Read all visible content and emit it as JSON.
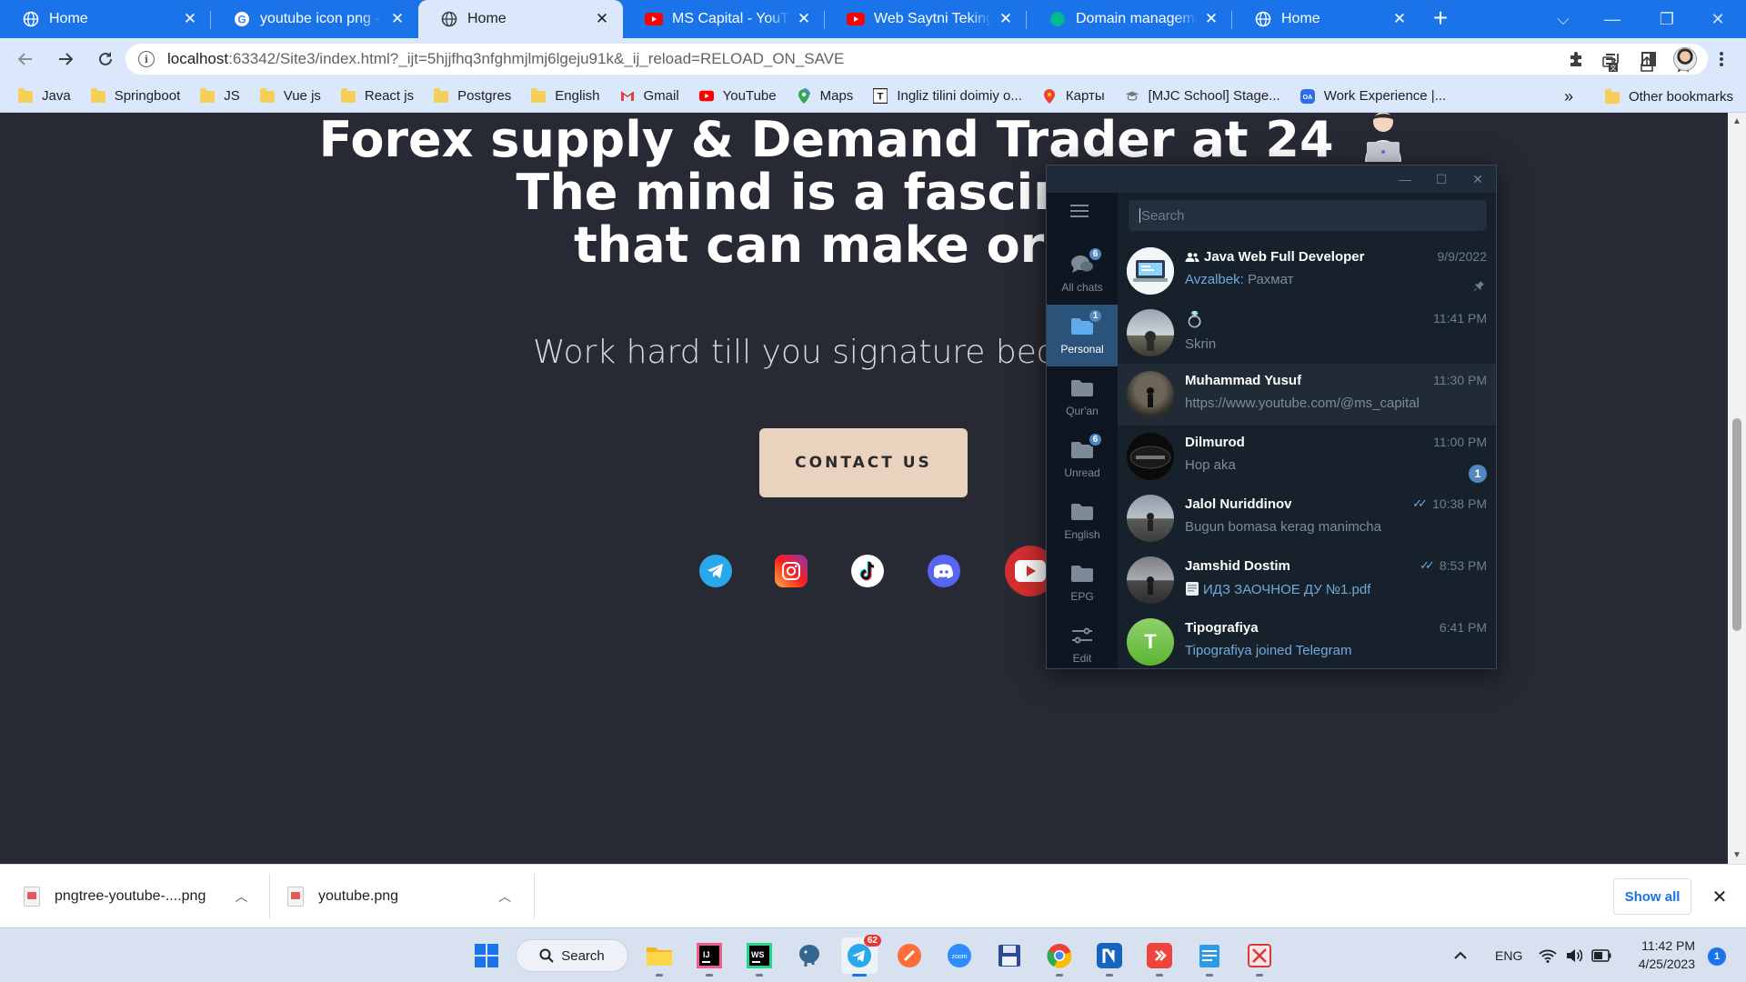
{
  "browser": {
    "tabs": [
      {
        "title": "Home",
        "icon": "globe-icon"
      },
      {
        "title": "youtube icon png - Google Search",
        "icon": "google-icon"
      },
      {
        "title": "Home",
        "icon": "globe-icon",
        "active": true
      },
      {
        "title": "MS Capital - YouTube",
        "icon": "youtube-icon"
      },
      {
        "title": "Web Saytni Tekinga Ho'",
        "icon": "youtube-icon"
      },
      {
        "title": "Domain management",
        "icon": "domain-icon"
      },
      {
        "title": "Home",
        "icon": "globe-icon"
      }
    ],
    "new_tab": "+",
    "close_glyph": "✕",
    "address": {
      "host": "localhost",
      "rest": ":63342/Site3/index.html?_ijt=5hjjfhq3nfghmjlmj6lgeju91k&_ij_reload=RELOAD_ON_SAVE"
    },
    "bookmarks": [
      {
        "label": "Java",
        "icon": "folder-icon"
      },
      {
        "label": "Springboot",
        "icon": "folder-icon"
      },
      {
        "label": "JS",
        "icon": "folder-icon"
      },
      {
        "label": "Vue js",
        "icon": "folder-icon"
      },
      {
        "label": "React js",
        "icon": "folder-icon"
      },
      {
        "label": "Postgres",
        "icon": "folder-icon"
      },
      {
        "label": "English",
        "icon": "folder-icon"
      },
      {
        "label": "Gmail",
        "icon": "gmail-icon"
      },
      {
        "label": "YouTube",
        "icon": "youtube-icon"
      },
      {
        "label": "Maps",
        "icon": "maps-icon"
      },
      {
        "label": "Ingliz tilini doimiy o...",
        "icon": "t-icon"
      },
      {
        "label": "Карты",
        "icon": "maps-icon"
      },
      {
        "label": "[MJC School] Stage...",
        "icon": "mjc-icon"
      },
      {
        "label": "Work Experience |...",
        "icon": "oa-icon"
      }
    ],
    "bookmarks_more": "»",
    "other_bookmarks": "Other bookmarks"
  },
  "page": {
    "title_line1": "Forex supply & Demand Trader at 24",
    "title_line2": "The mind is a fascinating",
    "title_line3": "that can make or bre",
    "subtitle": "Work hard till you signature becomes an",
    "contact_button": "CONTACT US",
    "social_icons": [
      "telegram-icon",
      "instagram-icon",
      "tiktok-icon",
      "discord-icon",
      "youtube-icon"
    ]
  },
  "telegram": {
    "search_placeholder": "Search",
    "folders": [
      {
        "label": "All chats",
        "badge": "6",
        "icon": "chats-icon"
      },
      {
        "label": "Personal",
        "badge": "1",
        "icon": "folder-icon",
        "active": true
      },
      {
        "label": "Qur'an",
        "badge": "",
        "icon": "folder-icon"
      },
      {
        "label": "Unread",
        "badge": "6",
        "icon": "folder-icon"
      },
      {
        "label": "English",
        "badge": "",
        "icon": "folder-icon"
      },
      {
        "label": "EPG",
        "badge": "",
        "icon": "folder-icon"
      },
      {
        "label": "Edit",
        "badge": "",
        "icon": "sliders-icon"
      }
    ],
    "chats": [
      {
        "name": "Java Web Full Developer",
        "sender": "Avzalbek:",
        "message": "Рахмат",
        "time": "9/9/2022",
        "group": true,
        "pinned": true
      },
      {
        "name": "",
        "message": "Skrin",
        "time": "11:41 PM",
        "ring_emoji": "💍"
      },
      {
        "name": "Muhammad Yusuf",
        "message": "https://www.youtube.com/@ms_capital",
        "time": "11:30 PM",
        "highlight": true
      },
      {
        "name": "Dilmurod",
        "message": "Hop aka",
        "time": "11:00 PM",
        "unread": "1"
      },
      {
        "name": "Jalol Nuriddinov",
        "message": "Bugun bomasa kerag manimcha",
        "time": "10:38 PM",
        "read": true
      },
      {
        "name": "Jamshid Dostim",
        "message": "ИДЗ ЗАОЧНОЕ ДУ №1.pdf",
        "time": "8:53 PM",
        "read": true,
        "file": true
      },
      {
        "name": "Tipografiya",
        "message": "Tipografiya joined Telegram",
        "time": "6:41 PM",
        "initial": "T"
      }
    ]
  },
  "downloads": {
    "items": [
      {
        "filename": "pngtree-youtube-....png"
      },
      {
        "filename": "youtube.png"
      }
    ],
    "show_all": "Show all"
  },
  "taskbar": {
    "search_label": "Search",
    "telegram_badge": "62",
    "language": "ENG",
    "time": "11:42 PM",
    "date": "4/25/2023",
    "notifications": "1"
  },
  "colors": {
    "tabstrip": "#1a73e8",
    "page_bg": "#272a34",
    "contact_button": "#e9d3bf",
    "telegram_bg": "#17212b",
    "telegram_accent": "#5288c1"
  }
}
